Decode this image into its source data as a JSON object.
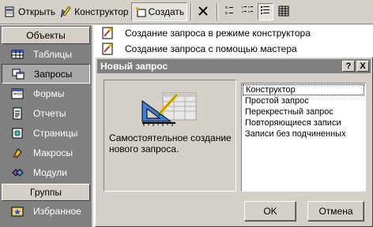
{
  "toolbar": {
    "open_label": "Открыть",
    "designer_label": "Конструктор",
    "create_label": "Создать"
  },
  "sidebar": {
    "header": "Объекты",
    "items": [
      {
        "label": "Таблицы",
        "icon": "table-icon"
      },
      {
        "label": "Запросы",
        "icon": "query-icon"
      },
      {
        "label": "Формы",
        "icon": "form-icon"
      },
      {
        "label": "Отчеты",
        "icon": "report-icon"
      },
      {
        "label": "Страницы",
        "icon": "page-icon"
      },
      {
        "label": "Макросы",
        "icon": "macro-icon"
      },
      {
        "label": "Модули",
        "icon": "module-icon"
      }
    ],
    "groups_header": "Группы",
    "favorites_label": "Избранное"
  },
  "main": {
    "items": [
      "Создание запроса в режиме конструктора",
      "Создание запроса с помощью мастера"
    ]
  },
  "dialog": {
    "title": "Новый запрос",
    "help_button": "?",
    "close_button": "X",
    "description": "Самостоятельное создание нового запроса.",
    "types": [
      "Конструктор",
      "Простой запрос",
      "Перекрестный запрос",
      "Повторяющиеся записи",
      "Записи без подчиненных"
    ],
    "selected_type": "Конструктор",
    "ok_label": "OK",
    "cancel_label": "Отмена"
  },
  "colors": {
    "window_bg": "#d4d0c8",
    "sidebar_bg": "#808080",
    "titlebar_inactive": "#808080"
  }
}
